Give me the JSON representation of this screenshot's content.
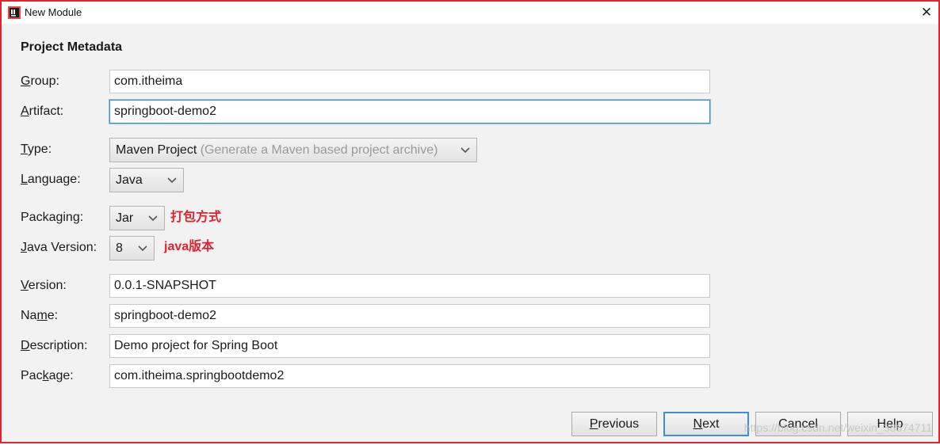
{
  "window": {
    "title": "New Module",
    "close_glyph": "✕",
    "app_icon": "intellij-icon"
  },
  "section": {
    "title": "Project Metadata"
  },
  "fields": {
    "group": {
      "label_m": "G",
      "label_rest": "roup:",
      "value": "com.itheima"
    },
    "artifact": {
      "label_m": "A",
      "label_rest": "rtifact:",
      "value": "springboot-demo2"
    },
    "version": {
      "label_m": "V",
      "label_rest": "ersion:",
      "value": "0.0.1-SNAPSHOT"
    },
    "name": {
      "label_pre": "Na",
      "label_m": "m",
      "label_rest": "e:",
      "value": "springboot-demo2"
    },
    "description": {
      "label_m": "D",
      "label_rest": "escription:",
      "value": "Demo project for Spring Boot"
    },
    "package": {
      "label_pre": "Pac",
      "label_m": "k",
      "label_rest": "age:",
      "value": "com.itheima.springbootdemo2"
    }
  },
  "combos": {
    "type": {
      "label_m": "T",
      "label_rest": "ype:",
      "value": "Maven Project",
      "hint": "(Generate a Maven based project archive)"
    },
    "language": {
      "label_m": "L",
      "label_rest": "anguage:",
      "value": "Java"
    },
    "packaging": {
      "label_pre": "Packa",
      "label_m": "g",
      "label_rest": "ing:",
      "value": "Jar"
    },
    "java_version": {
      "label_m": "J",
      "label_rest": "ava Version:",
      "value": "8"
    }
  },
  "annotations": {
    "packaging": "打包方式",
    "java_version": "java版本",
    "color": "#e0242f"
  },
  "buttons": {
    "previous": {
      "m": "P",
      "rest": "revious"
    },
    "next": {
      "m": "N",
      "rest": "ext"
    },
    "cancel": {
      "label": "Cancel"
    },
    "help": {
      "label": "Help"
    }
  },
  "watermark": "https://blog.csdn.net/weixin_38674711"
}
